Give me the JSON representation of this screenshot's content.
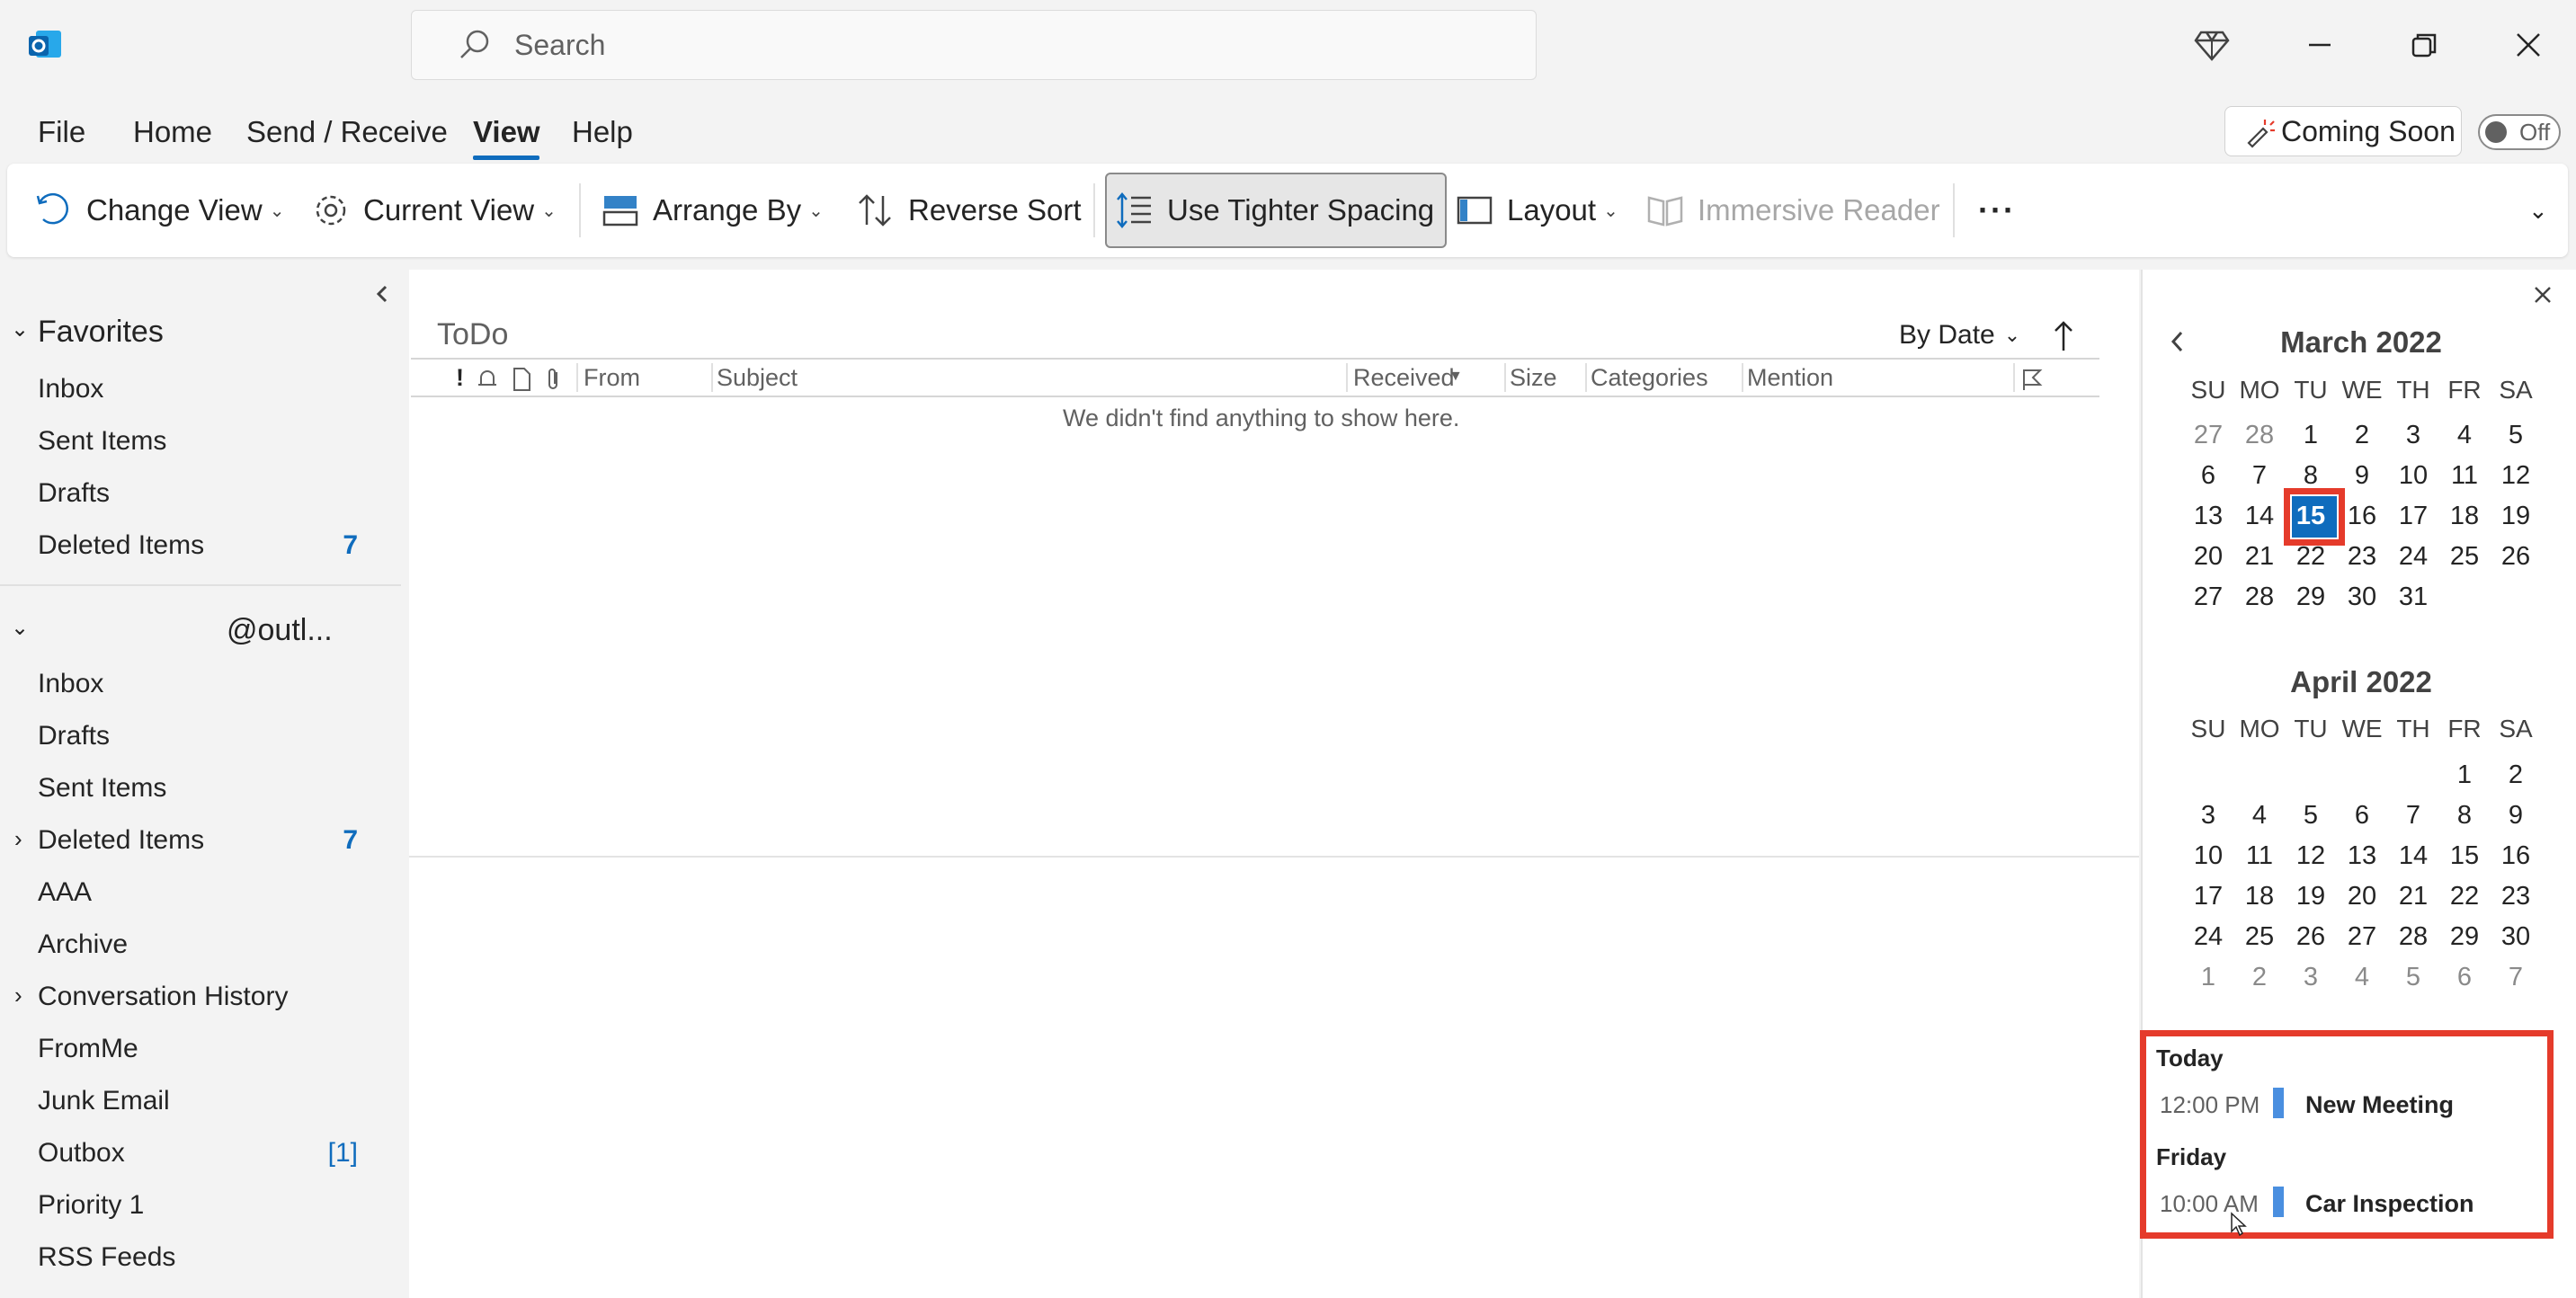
{
  "app": {
    "brand_color": "#0f6cbd",
    "highlight_color": "#e53b2b"
  },
  "search": {
    "placeholder": "Search"
  },
  "menu": {
    "items": [
      "File",
      "Home",
      "Send / Receive",
      "View",
      "Help"
    ],
    "active": "View"
  },
  "coming_soon": {
    "label": "Coming Soon",
    "toggle": "Off"
  },
  "ribbon": {
    "change_view": "Change View",
    "current_view": "Current View",
    "arrange_by": "Arrange By",
    "reverse_sort": "Reverse Sort",
    "tighter_spacing": "Use Tighter Spacing",
    "layout": "Layout",
    "immersive_reader": "Immersive Reader",
    "more": "···"
  },
  "favorites": {
    "header": "Favorites",
    "items": [
      {
        "label": "Inbox",
        "count": ""
      },
      {
        "label": "Sent Items",
        "count": ""
      },
      {
        "label": "Drafts",
        "count": ""
      },
      {
        "label": "Deleted Items",
        "count": "7"
      }
    ]
  },
  "account": {
    "email_suffix": "@outl...",
    "items": [
      {
        "label": "Inbox",
        "count": ""
      },
      {
        "label": "Drafts",
        "count": ""
      },
      {
        "label": "Sent Items",
        "count": ""
      },
      {
        "label": "Deleted Items",
        "count": "7"
      },
      {
        "label": "AAA",
        "count": ""
      },
      {
        "label": "Archive",
        "count": ""
      },
      {
        "label": "Conversation History",
        "count": ""
      },
      {
        "label": "FromMe",
        "count": ""
      },
      {
        "label": "Junk Email",
        "count": ""
      },
      {
        "label": "Outbox",
        "count": "[1]"
      },
      {
        "label": "Priority 1",
        "count": ""
      },
      {
        "label": "RSS Feeds",
        "count": ""
      }
    ]
  },
  "mail_list": {
    "title": "ToDo",
    "sort": "By Date",
    "columns": {
      "from": "From",
      "subject": "Subject",
      "received": "Received",
      "size": "Size",
      "categories": "Categories",
      "mention": "Mention"
    },
    "empty_message": "We didn't find anything to show here."
  },
  "calendar": {
    "dow": [
      "SU",
      "MO",
      "TU",
      "WE",
      "TH",
      "FR",
      "SA"
    ],
    "march": {
      "title": "March 2022",
      "weeks": [
        [
          "27",
          "28",
          "1",
          "2",
          "3",
          "4",
          "5"
        ],
        [
          "6",
          "7",
          "8",
          "9",
          "10",
          "11",
          "12"
        ],
        [
          "13",
          "14",
          "15",
          "16",
          "17",
          "18",
          "19"
        ],
        [
          "20",
          "21",
          "22",
          "23",
          "24",
          "25",
          "26"
        ],
        [
          "27",
          "28",
          "29",
          "30",
          "31",
          "",
          ""
        ]
      ]
    },
    "april": {
      "title": "April 2022",
      "weeks": [
        [
          "",
          "",
          "",
          "",
          "",
          "1",
          "2"
        ],
        [
          "3",
          "4",
          "5",
          "6",
          "7",
          "8",
          "9"
        ],
        [
          "10",
          "11",
          "12",
          "13",
          "14",
          "15",
          "16"
        ],
        [
          "17",
          "18",
          "19",
          "20",
          "21",
          "22",
          "23"
        ],
        [
          "24",
          "25",
          "26",
          "27",
          "28",
          "29",
          "30"
        ],
        [
          "1",
          "2",
          "3",
          "4",
          "5",
          "6",
          "7"
        ]
      ]
    },
    "today": "15"
  },
  "agenda": {
    "groups": [
      {
        "header": "Today",
        "time": "12:00 PM",
        "subject": "New Meeting"
      },
      {
        "header": "Friday",
        "time": "10:00 AM",
        "subject": "Car Inspection"
      }
    ]
  }
}
